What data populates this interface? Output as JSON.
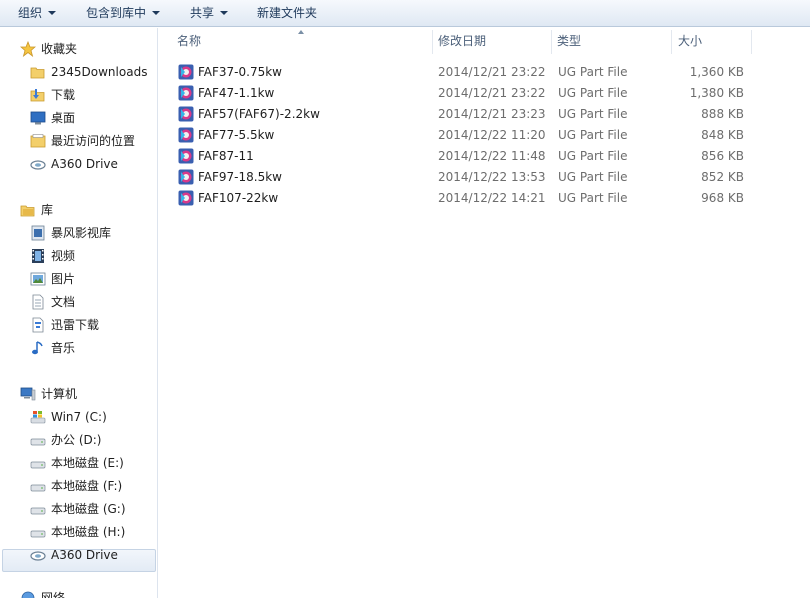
{
  "toolbar": {
    "organize": "组织",
    "include_in_library": "包含到库中",
    "share": "共享",
    "new_folder": "新建文件夹"
  },
  "nav": {
    "favorites_header": "收藏夹",
    "favorites": [
      "2345Downloads",
      "下载",
      "桌面",
      "最近访问的位置",
      "A360 Drive"
    ],
    "libraries_header": "库",
    "libraries": [
      "暴风影视库",
      "视频",
      "图片",
      "文档",
      "迅雷下载",
      "音乐"
    ],
    "computer_header": "计算机",
    "drives": [
      "Win7 (C:)",
      "办公 (D:)",
      "本地磁盘 (E:)",
      "本地磁盘 (F:)",
      "本地磁盘 (G:)",
      "本地磁盘 (H:)",
      "A360 Drive"
    ],
    "network_partial": "网络"
  },
  "columns": {
    "name": "名称",
    "date": "修改日期",
    "type": "类型",
    "size": "大小"
  },
  "files": [
    {
      "name": "FAF37-0.75kw",
      "date": "2014/12/21 23:22",
      "type": "UG Part File",
      "size": "1,360 KB"
    },
    {
      "name": "FAF47-1.1kw",
      "date": "2014/12/21 23:22",
      "type": "UG Part File",
      "size": "1,380 KB"
    },
    {
      "name": "FAF57(FAF67)-2.2kw",
      "date": "2014/12/21 23:23",
      "type": "UG Part File",
      "size": "888 KB"
    },
    {
      "name": "FAF77-5.5kw",
      "date": "2014/12/22 11:20",
      "type": "UG Part File",
      "size": "848 KB"
    },
    {
      "name": "FAF87-11",
      "date": "2014/12/22 11:48",
      "type": "UG Part File",
      "size": "856 KB"
    },
    {
      "name": "FAF97-18.5kw",
      "date": "2014/12/22 13:53",
      "type": "UG Part File",
      "size": "852 KB"
    },
    {
      "name": "FAF107-22kw",
      "date": "2014/12/22 14:21",
      "type": "UG Part File",
      "size": "968 KB"
    }
  ]
}
